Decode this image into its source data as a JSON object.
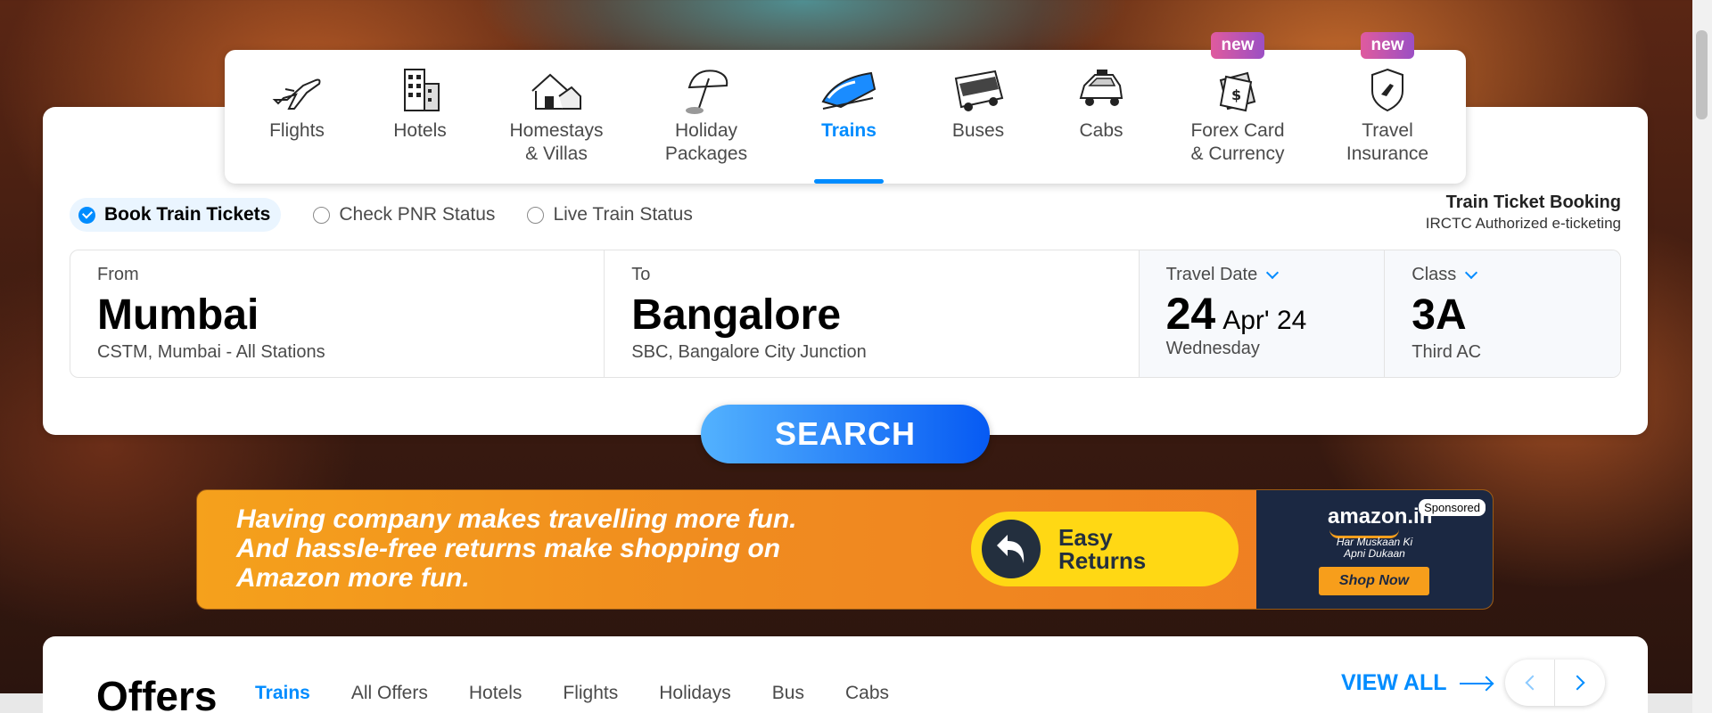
{
  "nav": {
    "items": [
      {
        "label": "Flights",
        "icon": "plane-icon",
        "badge": ""
      },
      {
        "label": "Hotels",
        "icon": "hotel-icon",
        "badge": ""
      },
      {
        "label": "Homestays\n& Villas",
        "icon": "homestay-icon",
        "badge": ""
      },
      {
        "label": "Holiday\nPackages",
        "icon": "beach-umbrella-icon",
        "badge": ""
      },
      {
        "label": "Trains",
        "icon": "train-icon",
        "badge": "",
        "active": true
      },
      {
        "label": "Buses",
        "icon": "bus-icon",
        "badge": ""
      },
      {
        "label": "Cabs",
        "icon": "cab-icon",
        "badge": ""
      },
      {
        "label": "Forex Card\n& Currency",
        "icon": "forex-card-icon",
        "badge": "new"
      },
      {
        "label": "Travel\nInsurance",
        "icon": "insurance-shield-icon",
        "badge": "new"
      }
    ]
  },
  "options": {
    "book": "Book Train Tickets",
    "pnr": "Check PNR Status",
    "live": "Live Train Status"
  },
  "promo": {
    "title": "Train Ticket Booking",
    "subtitle": "IRCTC Authorized e-ticketing"
  },
  "fields": {
    "from": {
      "label": "From",
      "city": "Mumbai",
      "station": "CSTM, Mumbai - All Stations"
    },
    "to": {
      "label": "To",
      "city": "Bangalore",
      "station": "SBC, Bangalore City Junction"
    },
    "date": {
      "label": "Travel Date",
      "day": "24",
      "month_year": "Apr' 24",
      "weekday": "Wednesday"
    },
    "class": {
      "label": "Class",
      "code": "3A",
      "name": "Third AC"
    }
  },
  "search": {
    "label": "SEARCH"
  },
  "ad": {
    "line1": "Having company makes travelling more fun.",
    "line2": "And hassle-free returns make shopping on",
    "line3": "Amazon more fun.",
    "pill_line1": "Easy",
    "pill_line2": "Returns",
    "brand": "amazon.in",
    "sponsored": "Sponsored",
    "tagline": "Har Muskaan Ki\nApni Dukaan",
    "cta": "Shop Now"
  },
  "offers": {
    "title": "Offers",
    "tabs": [
      "Trains",
      "All Offers",
      "Hotels",
      "Flights",
      "Holidays",
      "Bus",
      "Cabs"
    ],
    "active_tab": "Trains",
    "view_all": "VIEW ALL"
  },
  "colors": {
    "accent": "#008cff",
    "ad_orange": "#f08c1f",
    "badge": "#c44fb0"
  }
}
